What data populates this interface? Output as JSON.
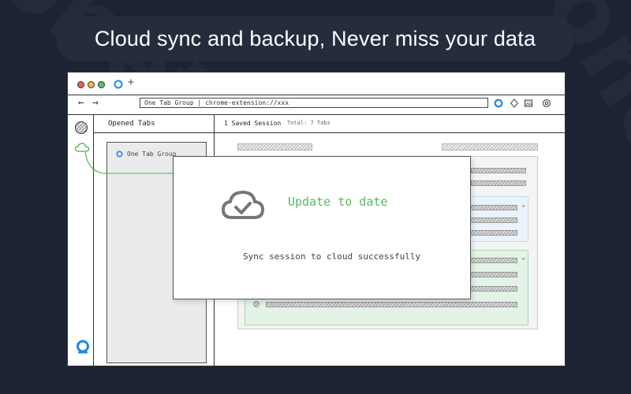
{
  "headline": "Cloud sync and backup, Never miss your data",
  "watermark": "onetab.",
  "browser": {
    "address": "One Tab Group | chrome-extension://xxx",
    "new_tab_symbol": "+",
    "back_symbol": "←",
    "forward_symbol": "→"
  },
  "opened_tabs": {
    "title": "Opened Tabs",
    "item": "One Tab Group"
  },
  "sessions": {
    "title": "1 Saved Session",
    "total": "Total: 7 Tabs"
  },
  "modal": {
    "status": "Update to date",
    "message": "Sync session to cloud successfully"
  },
  "colors": {
    "background": "#1c2333",
    "pill": "#252d3d",
    "accent_green": "#4caf50",
    "accent_blue": "#1e88e5"
  },
  "icons": [
    "cloud-check-icon",
    "cloud-icon",
    "onetab-logo-icon",
    "avatar-icon",
    "diamond-icon",
    "gallery-icon",
    "gear-icon",
    "chevron-down-icon"
  ]
}
